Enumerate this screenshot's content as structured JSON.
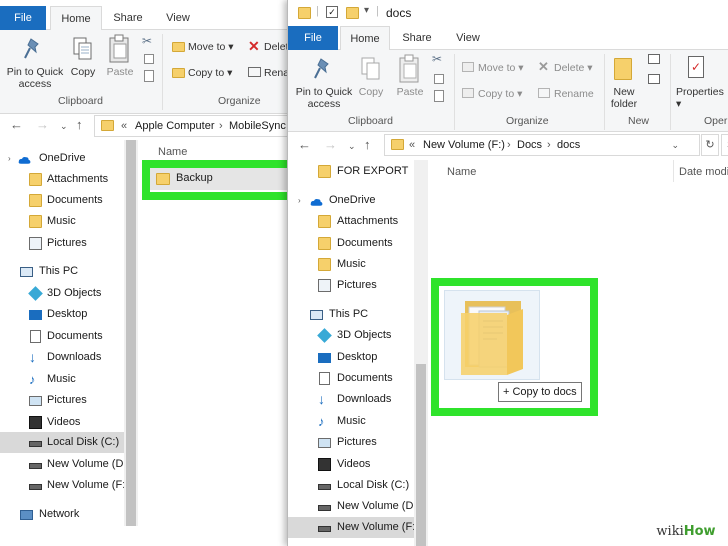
{
  "left": {
    "tabs": {
      "file": "File",
      "home": "Home",
      "share": "Share",
      "view": "View"
    },
    "ribbon": {
      "pin_label": "Pin to Quick access",
      "copy_label": "Copy",
      "paste_label": "Paste",
      "move_to": "Move to",
      "copy_to": "Copy to",
      "delete": "Delet",
      "rename": "Rena",
      "group_clipboard": "Clipboard",
      "group_organize": "Organize"
    },
    "address": {
      "chevrons": "«",
      "path": [
        "Apple Computer",
        "MobileSync"
      ]
    },
    "nav": [
      {
        "label": "OneDrive",
        "icon": "cloud-icon"
      },
      {
        "label": "Attachments",
        "icon": "folder-icon"
      },
      {
        "label": "Documents",
        "icon": "folder-icon"
      },
      {
        "label": "Music",
        "icon": "folder-icon"
      },
      {
        "label": "Pictures",
        "icon": "folder-icon"
      },
      {
        "label": "This PC",
        "icon": "computer-icon"
      },
      {
        "label": "3D Objects",
        "icon": "cube-icon"
      },
      {
        "label": "Desktop",
        "icon": "desktop-icon"
      },
      {
        "label": "Documents",
        "icon": "document-icon"
      },
      {
        "label": "Downloads",
        "icon": "download-icon"
      },
      {
        "label": "Music",
        "icon": "music-icon"
      },
      {
        "label": "Pictures",
        "icon": "pictures-icon"
      },
      {
        "label": "Videos",
        "icon": "videos-icon"
      },
      {
        "label": "Local Disk (C:)",
        "icon": "drive-icon",
        "selected": true
      },
      {
        "label": "New Volume (D:",
        "icon": "drive-icon"
      },
      {
        "label": "New Volume (F:)",
        "icon": "drive-icon"
      },
      {
        "label": "Network",
        "icon": "network-icon"
      }
    ],
    "column_name": "Name",
    "files": [
      {
        "name": "Backup"
      }
    ]
  },
  "right": {
    "title": "docs",
    "tabs": {
      "file": "File",
      "home": "Home",
      "share": "Share",
      "view": "View"
    },
    "ribbon": {
      "pin_label": "Pin to Quick access",
      "copy_label": "Copy",
      "paste_label": "Paste",
      "move_to": "Move to",
      "copy_to": "Copy to",
      "delete": "Delete",
      "rename": "Rename",
      "new_folder": "New folder",
      "properties": "Properties",
      "group_clipboard": "Clipboard",
      "group_organize": "Organize",
      "group_new": "New",
      "group_open": "Oper"
    },
    "address": {
      "chevrons": "«",
      "path": [
        "New Volume (F:)",
        "Docs",
        "docs"
      ]
    },
    "search_placeholder": "Se",
    "nav": [
      {
        "label": "FOR EXPORT",
        "icon": "folder-icon"
      },
      {
        "label": "OneDrive",
        "icon": "cloud-icon"
      },
      {
        "label": "Attachments",
        "icon": "folder-icon"
      },
      {
        "label": "Documents",
        "icon": "folder-icon"
      },
      {
        "label": "Music",
        "icon": "folder-icon"
      },
      {
        "label": "Pictures",
        "icon": "folder-icon"
      },
      {
        "label": "This PC",
        "icon": "computer-icon"
      },
      {
        "label": "3D Objects",
        "icon": "cube-icon"
      },
      {
        "label": "Desktop",
        "icon": "desktop-icon"
      },
      {
        "label": "Documents",
        "icon": "document-icon"
      },
      {
        "label": "Downloads",
        "icon": "download-icon"
      },
      {
        "label": "Music",
        "icon": "music-icon"
      },
      {
        "label": "Pictures",
        "icon": "pictures-icon"
      },
      {
        "label": "Videos",
        "icon": "videos-icon"
      },
      {
        "label": "Local Disk (C:)",
        "icon": "drive-icon"
      },
      {
        "label": "New Volume (D:",
        "icon": "drive-icon"
      },
      {
        "label": "New Volume (F:)",
        "icon": "drive-icon",
        "selected": true
      }
    ],
    "column_name": "Name",
    "column_date": "Date modi",
    "drag_tooltip": "+ Copy to docs"
  },
  "colors": {
    "highlight_green": "#2fe32b",
    "file_tab_blue": "#1a6dbf",
    "folder_yellow": "#f6d06b"
  },
  "watermark": {
    "brand_a": "wiki",
    "brand_b": "How"
  }
}
